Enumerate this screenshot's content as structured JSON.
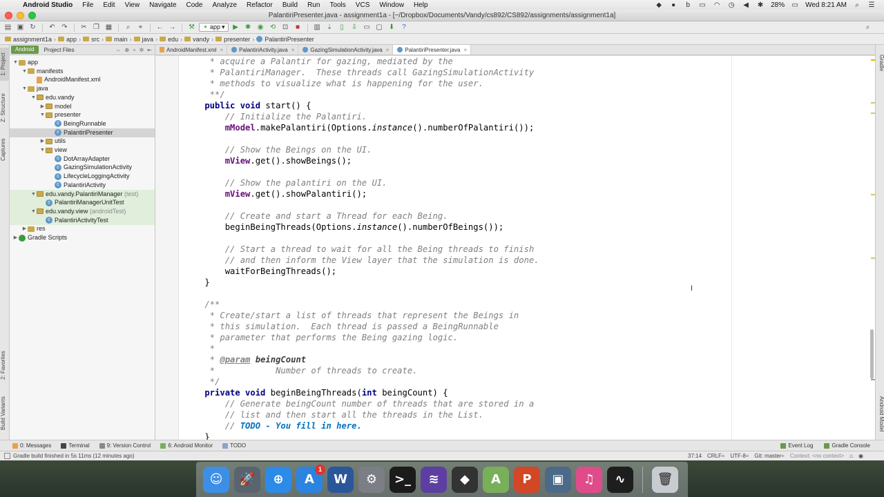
{
  "menubar": {
    "app_name": "Android Studio",
    "items": [
      "File",
      "Edit",
      "View",
      "Navigate",
      "Code",
      "Analyze",
      "Refactor",
      "Build",
      "Run",
      "Tools",
      "VCS",
      "Window",
      "Help"
    ],
    "battery": "28%",
    "clock": "Wed 8:21 AM"
  },
  "window": {
    "title": "PalantiriPresenter.java - assignment1a - [~/Dropbox/Documents/Vandy/cs892/CS892/assignments/assignment1a]"
  },
  "toolbar": {
    "run_config": "app"
  },
  "breadcrumb": [
    "assignment1a",
    "app",
    "src",
    "main",
    "java",
    "edu",
    "vandy",
    "presenter",
    "PalantiriPresenter"
  ],
  "project_panel": {
    "view_tab": "Android",
    "other_tab": "Project Files",
    "tree": [
      {
        "label": "app",
        "sub": "",
        "indent": 0,
        "arrow": "▼",
        "icon": "folder",
        "state": ""
      },
      {
        "label": "manifests",
        "sub": "",
        "indent": 1,
        "arrow": "▼",
        "icon": "folder",
        "state": ""
      },
      {
        "label": "AndroidManifest.xml",
        "sub": "",
        "indent": 2,
        "arrow": "",
        "icon": "xml",
        "state": ""
      },
      {
        "label": "java",
        "sub": "",
        "indent": 1,
        "arrow": "▼",
        "icon": "folder",
        "state": ""
      },
      {
        "label": "edu.vandy",
        "sub": "",
        "indent": 2,
        "arrow": "▼",
        "icon": "pkg",
        "state": ""
      },
      {
        "label": "model",
        "sub": "",
        "indent": 3,
        "arrow": "▶",
        "icon": "pkg",
        "state": ""
      },
      {
        "label": "presenter",
        "sub": "",
        "indent": 3,
        "arrow": "▼",
        "icon": "pkg",
        "state": ""
      },
      {
        "label": "BeingRunnable",
        "sub": "",
        "indent": 4,
        "arrow": "",
        "icon": "class",
        "state": ""
      },
      {
        "label": "PalantiriPresenter",
        "sub": "",
        "indent": 4,
        "arrow": "",
        "icon": "class",
        "state": "sel"
      },
      {
        "label": "utils",
        "sub": "",
        "indent": 3,
        "arrow": "▶",
        "icon": "pkg",
        "state": ""
      },
      {
        "label": "view",
        "sub": "",
        "indent": 3,
        "arrow": "▼",
        "icon": "pkg",
        "state": ""
      },
      {
        "label": "DotArrayAdapter",
        "sub": "",
        "indent": 4,
        "arrow": "",
        "icon": "class",
        "state": ""
      },
      {
        "label": "GazingSimulationActivity",
        "sub": "",
        "indent": 4,
        "arrow": "",
        "icon": "class",
        "state": ""
      },
      {
        "label": "LifecycleLoggingActivity",
        "sub": "",
        "indent": 4,
        "arrow": "",
        "icon": "class",
        "state": ""
      },
      {
        "label": "PalantiriActivity",
        "sub": "",
        "indent": 4,
        "arrow": "",
        "icon": "class",
        "state": ""
      },
      {
        "label": "edu.vandy.PalantiriManager",
        "sub": " (test)",
        "indent": 2,
        "arrow": "▼",
        "icon": "pkg",
        "state": "test"
      },
      {
        "label": "PalantiriManagerUnitTest",
        "sub": "",
        "indent": 3,
        "arrow": "",
        "icon": "class",
        "state": "test"
      },
      {
        "label": "edu.vandy.view",
        "sub": " (androidTest)",
        "indent": 2,
        "arrow": "▼",
        "icon": "pkg",
        "state": "test"
      },
      {
        "label": "PalantiriActivityTest",
        "sub": "",
        "indent": 3,
        "arrow": "",
        "icon": "class",
        "state": "test"
      },
      {
        "label": "res",
        "sub": "",
        "indent": 1,
        "arrow": "▶",
        "icon": "folder",
        "state": ""
      },
      {
        "label": "Gradle Scripts",
        "sub": "",
        "indent": 0,
        "arrow": "▶",
        "icon": "gradle",
        "state": ""
      }
    ]
  },
  "side_tabs": {
    "left_top": [
      "1: Project",
      "Z: Structure",
      "Captures"
    ],
    "left_bottom": [
      "2: Favorites",
      "Build Variants"
    ],
    "right": [
      "Gradle",
      "Android Model"
    ]
  },
  "editor": {
    "tabs": [
      {
        "label": "AndroidManifest.xml",
        "type": "xml",
        "active": false
      },
      {
        "label": "PalantiriActivity.java",
        "type": "cls",
        "active": false
      },
      {
        "label": "GazingSimulationActivity.java",
        "type": "cls",
        "active": false
      },
      {
        "label": "PalantiriPresenter.java",
        "type": "cls",
        "active": true
      }
    ],
    "code_lines": [
      [
        [
          "cm",
          "     * acquire a Palantir for gazing, mediated by the"
        ]
      ],
      [
        [
          "cm",
          "     * PalantiriManager.  These threads call GazingSimulationActivity"
        ]
      ],
      [
        [
          "cm",
          "     * methods to visualize what is happening for the user."
        ]
      ],
      [
        [
          "cm",
          "     **/"
        ]
      ],
      [
        [
          "kw",
          "    public void "
        ],
        [
          "",
          "start() {"
        ]
      ],
      [
        [
          "cm",
          "        // Initialize the Palantiri."
        ]
      ],
      [
        [
          "fld",
          "        mModel"
        ],
        [
          "",
          ".makePalantiri(Options."
        ],
        [
          "st",
          "instance"
        ],
        [
          "",
          "().numberOfPalantiri());"
        ]
      ],
      [
        [
          "",
          ""
        ]
      ],
      [
        [
          "cm",
          "        // Show the Beings on the UI."
        ]
      ],
      [
        [
          "fld",
          "        mView"
        ],
        [
          "",
          ".get().showBeings();"
        ]
      ],
      [
        [
          "",
          ""
        ]
      ],
      [
        [
          "cm",
          "        // Show the palantiri on the UI."
        ]
      ],
      [
        [
          "fld",
          "        mView"
        ],
        [
          "",
          ".get().showPalantiri();"
        ]
      ],
      [
        [
          "",
          ""
        ]
      ],
      [
        [
          "cm",
          "        // Create and start a Thread for each Being."
        ]
      ],
      [
        [
          "",
          "        beginBeingThreads(Options."
        ],
        [
          "st",
          "instance"
        ],
        [
          "",
          "().numberOfBeings());"
        ]
      ],
      [
        [
          "",
          ""
        ]
      ],
      [
        [
          "cm",
          "        // Start a thread to wait for all the Being threads to finish"
        ]
      ],
      [
        [
          "cm",
          "        // and then inform the View layer that the simulation is done."
        ]
      ],
      [
        [
          "",
          "        waitForBeingThreads();"
        ]
      ],
      [
        [
          "",
          "    }"
        ]
      ],
      [
        [
          "",
          ""
        ]
      ],
      [
        [
          "cm",
          "    /**"
        ]
      ],
      [
        [
          "cm",
          "     * Create/start a list of threads that represent the Beings in"
        ]
      ],
      [
        [
          "cm",
          "     * this simulation.  Each thread is passed a BeingRunnable"
        ]
      ],
      [
        [
          "cm",
          "     * parameter that performs the Being gazing logic."
        ]
      ],
      [
        [
          "cm",
          "     *"
        ]
      ],
      [
        [
          "cm",
          "     * "
        ],
        [
          "tag",
          "@param"
        ],
        [
          "cm",
          " "
        ],
        [
          "pname",
          "beingCount"
        ]
      ],
      [
        [
          "cm",
          "     *            Number of threads to create."
        ]
      ],
      [
        [
          "cm",
          "     */"
        ]
      ],
      [
        [
          "kw",
          "    private void "
        ],
        [
          "",
          "beginBeingThreads("
        ],
        [
          "kw",
          "int "
        ],
        [
          "",
          "beingCount) {"
        ]
      ],
      [
        [
          "cm",
          "        // Generate beingCount number of threads that are stored in a"
        ]
      ],
      [
        [
          "cm",
          "        // list and then start all the threads in the List."
        ]
      ],
      [
        [
          "cm",
          "        // "
        ],
        [
          "todo",
          "TODO - You fill in here."
        ]
      ],
      [
        [
          "",
          "    }"
        ]
      ]
    ]
  },
  "bottom_tools": {
    "left": [
      "0: Messages",
      "Terminal",
      "9: Version Control",
      "6: Android Monitor",
      "TODO"
    ],
    "right": [
      "Event Log",
      "Gradle Console"
    ]
  },
  "status": {
    "message": "Gradle build finished in 5s 11ms (12 minutes ago)",
    "position": "37:14",
    "line_sep": "CRLF÷",
    "encoding": "UTF-8÷",
    "git": "Git: master÷",
    "context": "Context: <no context>"
  },
  "dock": {
    "items": [
      {
        "name": "finder-icon",
        "glyph": "☺",
        "bg": "#3d8fe6",
        "badge": ""
      },
      {
        "name": "launchpad-icon",
        "glyph": "🚀",
        "bg": "#5a6370",
        "badge": ""
      },
      {
        "name": "safari-icon",
        "glyph": "⊕",
        "bg": "#2d8be8",
        "badge": ""
      },
      {
        "name": "app-store-icon",
        "glyph": "A",
        "bg": "#2a84e0",
        "badge": "1"
      },
      {
        "name": "word-icon",
        "glyph": "W",
        "bg": "#2b579a",
        "badge": ""
      },
      {
        "name": "system-preferences-icon",
        "glyph": "⚙",
        "bg": "#7b7f85",
        "badge": ""
      },
      {
        "name": "terminal-icon",
        "glyph": ">_",
        "bg": "#1b1b1b",
        "badge": ""
      },
      {
        "name": "emacs-icon",
        "glyph": "≋",
        "bg": "#5c3fa0",
        "badge": ""
      },
      {
        "name": "unity-icon",
        "glyph": "◆",
        "bg": "#333333",
        "badge": ""
      },
      {
        "name": "android-studio-icon",
        "glyph": "A",
        "bg": "#78b05a",
        "badge": ""
      },
      {
        "name": "powerpoint-icon",
        "glyph": "P",
        "bg": "#d24726",
        "badge": ""
      },
      {
        "name": "camtasia-icon",
        "glyph": "▣",
        "bg": "#4b6a88",
        "badge": ""
      },
      {
        "name": "itunes-icon",
        "glyph": "♫",
        "bg": "#e04c8b",
        "badge": ""
      },
      {
        "name": "activity-monitor-icon",
        "glyph": "∿",
        "bg": "#1e1e1e",
        "badge": ""
      }
    ],
    "trash": {
      "name": "trash-icon",
      "glyph": "🗑",
      "bg": "#c8ccd0"
    }
  }
}
